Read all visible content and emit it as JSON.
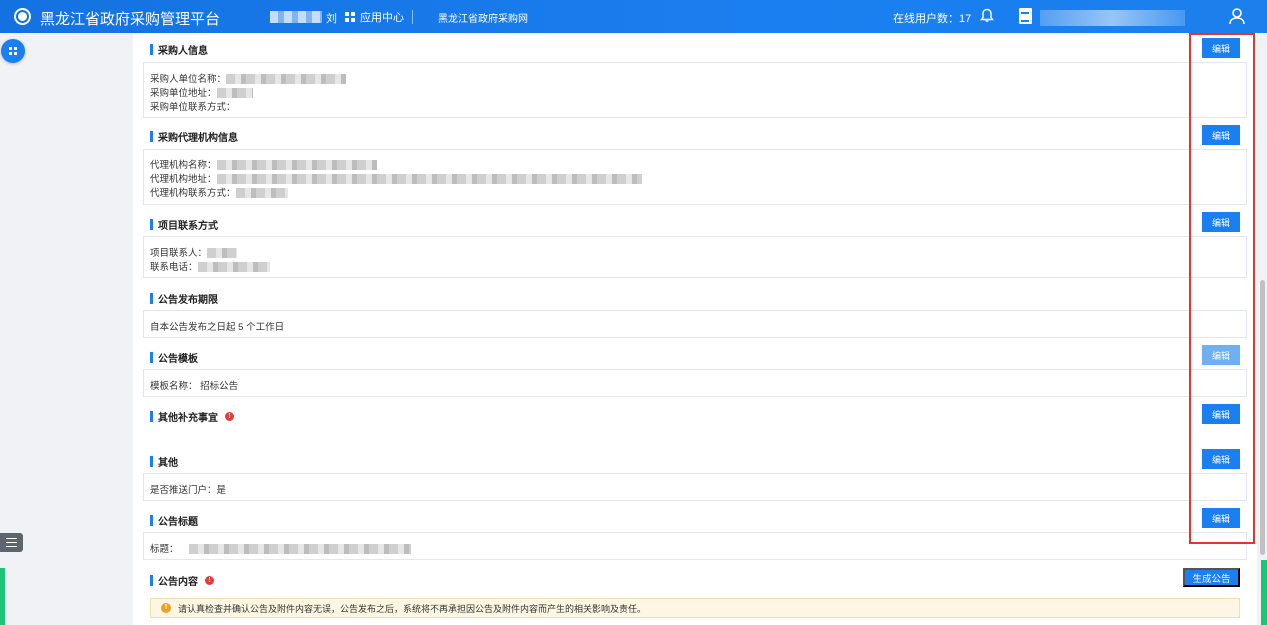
{
  "header": {
    "brand": "黑龙江省政府采购管理平台",
    "blurred_suffix": "刘",
    "app_center": "应用中心",
    "portal_link": "黑龙江省政府采购网",
    "online_users": "在线用户数：17"
  },
  "sections": {
    "purchaser": {
      "title": "采购人信息",
      "rows": [
        "采购人单位名称：",
        "采购单位地址：",
        "采购单位联系方式："
      ],
      "edit_label": "编辑"
    },
    "agency": {
      "title": "采购代理机构信息",
      "rows": [
        "代理机构名称：",
        "代理机构地址：",
        "代理机构联系方式："
      ],
      "edit_label": "编辑"
    },
    "contact": {
      "title": "项目联系方式",
      "rows": [
        "项目联系人：",
        "联系电话："
      ],
      "edit_label": "编辑"
    },
    "period": {
      "title": "公告发布期限",
      "text": "自本公告发布之日起 5 个工作日"
    },
    "template": {
      "title": "公告模板",
      "text": "模板名称： 招标公告",
      "edit_label": "编辑"
    },
    "supplement": {
      "title": "其他补充事宜",
      "warn": "!",
      "edit_label": "编辑"
    },
    "other": {
      "title": "其他",
      "text": "是否推送门户：是",
      "edit_label": "编辑"
    },
    "notice_title": {
      "title": "公告标题",
      "label": "标题：",
      "edit_label": "编辑"
    },
    "content": {
      "title": "公告内容",
      "warn": "!",
      "generate_label": "生成公告",
      "notice_icon": "!",
      "notice_text": "请认真检查并确认公告及附件内容无误，公告发布之后，系统将不再承担因公告及附件内容而产生的相关影响及责任。"
    }
  },
  "colors": {
    "primary": "#1a7ff0",
    "highlight": "#e0362f",
    "accent_green": "#1fc37a"
  },
  "icons": [
    "logo-icon",
    "app-grid-icon",
    "bell-icon",
    "document-icon",
    "user-icon",
    "menu-grid-icon",
    "list-icon",
    "warning-icon"
  ]
}
